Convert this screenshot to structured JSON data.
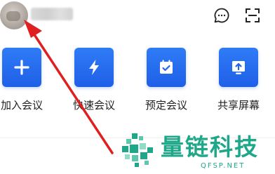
{
  "header": {
    "chat_icon": "chat-bubble-icon",
    "scan_icon": "scan-icon"
  },
  "actions": [
    {
      "label": "加入会议",
      "icon": "plus-icon"
    },
    {
      "label": "快速会议",
      "icon": "lightning-icon"
    },
    {
      "label": "预定会议",
      "icon": "calendar-check-icon"
    },
    {
      "label": "共享屏幕",
      "icon": "screen-share-icon"
    }
  ],
  "colors": {
    "tile_blue": "#2a6ff0",
    "arrow_red": "#e02020",
    "watermark_green": "#1fa789"
  },
  "watermark": {
    "title": "量链科技",
    "subtitle": "QFSP.NET"
  }
}
